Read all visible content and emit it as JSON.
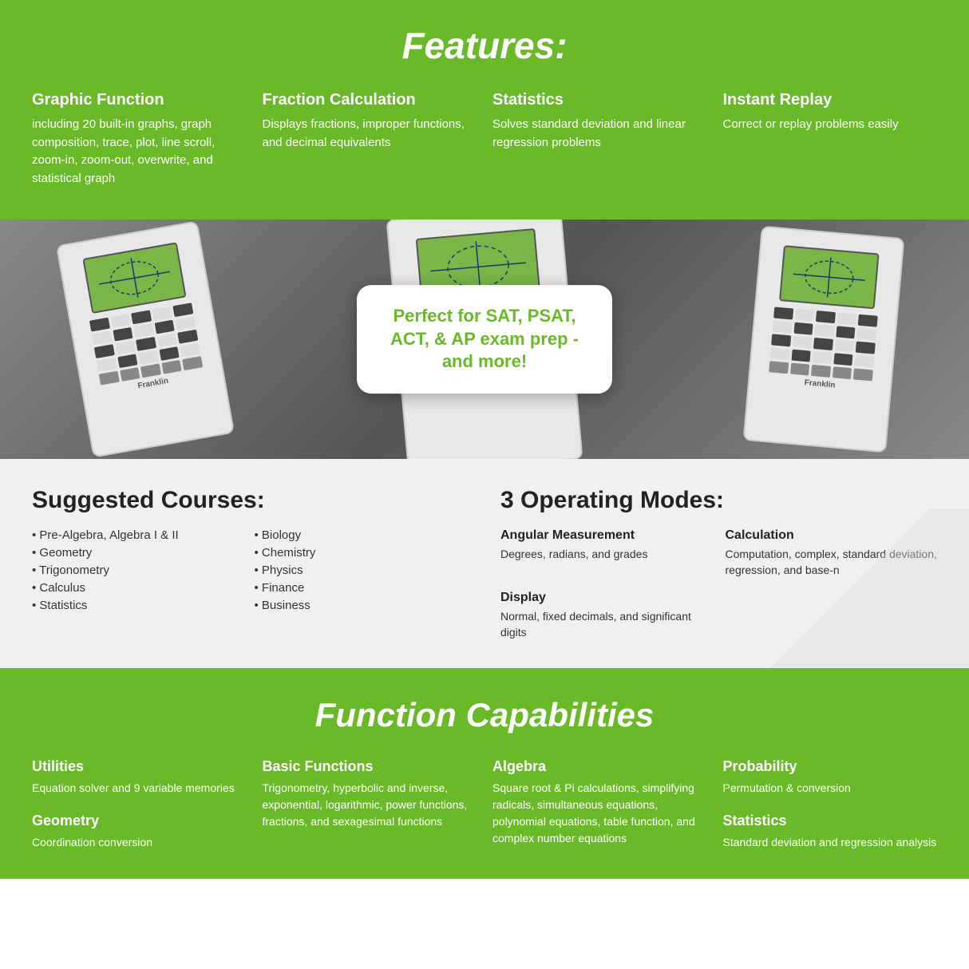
{
  "features": {
    "title": "Features:",
    "items": [
      {
        "heading": "Graphic Function",
        "body": "including 20 built-in graphs, graph composition, trace, plot, line scroll, zoom-in, zoom-out, overwrite, and statistical graph"
      },
      {
        "heading": "Fraction Calculation",
        "body": "Displays fractions, improper functions, and decimal equivalents"
      },
      {
        "heading": "Statistics",
        "body": "Solves standard deviation and linear regression problems"
      },
      {
        "heading": "Instant Replay",
        "body": "Correct or replay problems easily"
      }
    ]
  },
  "banner": {
    "callout": "Perfect for SAT, PSAT, ACT, & AP exam prep - and more!"
  },
  "courses": {
    "heading": "Suggested Courses:",
    "list1": [
      "• Pre-Algebra, Algebra I & II",
      "• Geometry",
      "• Trigonometry",
      "• Calculus",
      "• Statistics"
    ],
    "list2": [
      "• Biology",
      "• Chemistry",
      "• Physics",
      "• Finance",
      "• Business"
    ]
  },
  "modes": {
    "heading": "3 Operating Modes:",
    "items": [
      {
        "heading": "Angular Measurement",
        "body": "Degrees, radians, and grades"
      },
      {
        "heading": "Calculation",
        "body": "Computation, complex, standard deviation, regression, and base-n"
      },
      {
        "heading": "Display",
        "body": "Normal, fixed decimals, and significant digits"
      }
    ]
  },
  "functions": {
    "title": "Function Capabilities",
    "cols": [
      {
        "items": [
          {
            "heading": "Utilities",
            "body": "Equation solver and 9 variable memories"
          },
          {
            "heading": "Geometry",
            "body": "Coordination conversion"
          }
        ]
      },
      {
        "items": [
          {
            "heading": "Basic Functions",
            "body": "Trigonometry, hyperbolic and inverse, exponential, logarithmic, power functions, fractions, and sexagesimal functions"
          }
        ]
      },
      {
        "items": [
          {
            "heading": "Algebra",
            "body": "Square root & Pi calculations, simplifying radicals, simultaneous equations, polynomial equations, table function, and complex number equations"
          }
        ]
      },
      {
        "items": [
          {
            "heading": "Probability",
            "body": "Permutation & conversion"
          },
          {
            "heading": "Statistics",
            "body": "Standard deviation and regression analysis"
          }
        ]
      }
    ]
  }
}
